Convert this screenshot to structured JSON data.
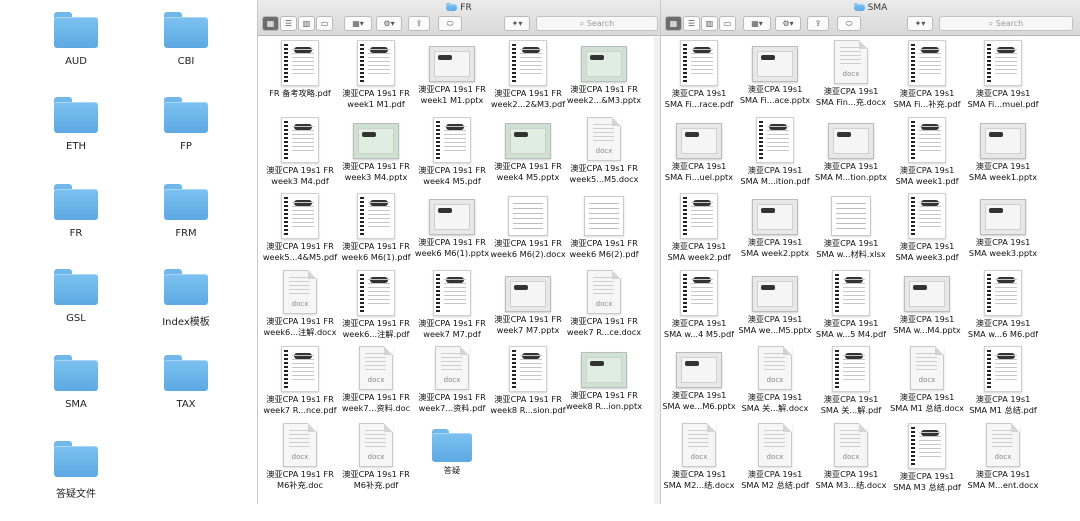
{
  "desktop": {
    "folders": [
      "AUD",
      "CBI",
      "ETH",
      "FP",
      "FR",
      "FRM",
      "GSL",
      "Index模板",
      "SMA",
      "TAX",
      "答疑文件"
    ]
  },
  "windows": [
    {
      "title": "FR",
      "search_placeholder": "Search",
      "toolbar": {
        "share": "⇪",
        "tag": "⬭",
        "dropbox": "✦"
      },
      "items": [
        {
          "name": "FR 备考攻略.pdf",
          "type": "pdf"
        },
        {
          "name": "澳亚CPA 19s1 FR\nweek1 M1.pdf",
          "type": "pdf"
        },
        {
          "name": "澳亚CPA 19s1 FR\nweek1 M1.pptx",
          "type": "ppt"
        },
        {
          "name": "澳亚CPA 19s1 FR\nweek2...2&M3.pdf",
          "type": "pdf"
        },
        {
          "name": "澳亚CPA 19s1 FR\nweek2...&M3.pptx",
          "type": "pptg"
        },
        {
          "name": "澳亚CPA 19s1 FR\nweek3 M4.pdf",
          "type": "pdf"
        },
        {
          "name": "澳亚CPA 19s1 FR\nweek3 M4.pptx",
          "type": "pptg"
        },
        {
          "name": "澳亚CPA 19s1 FR\nweek4 M5.pdf",
          "type": "pdf"
        },
        {
          "name": "澳亚CPA 19s1 FR\nweek4 M5.pptx",
          "type": "pptg"
        },
        {
          "name": "澳亚CPA 19s1 FR\nweek5...M5.docx",
          "type": "doc"
        },
        {
          "name": "澳亚CPA 19s1 FR\nweek5...4&M5.pdf",
          "type": "pdf"
        },
        {
          "name": "澳亚CPA 19s1 FR\nweek6 M6(1).pdf",
          "type": "pdf"
        },
        {
          "name": "澳亚CPA 19s1 FR\nweek6 M6(1).pptx",
          "type": "ppt"
        },
        {
          "name": "澳亚CPA 19s1 FR\nweek6 M6(2).docx",
          "type": "xls"
        },
        {
          "name": "澳亚CPA 19s1 FR\nweek6 M6(2).pdf",
          "type": "xls"
        },
        {
          "name": "澳亚CPA 19s1 FR\nweek6...注解.docx",
          "type": "doc"
        },
        {
          "name": "澳亚CPA 19s1 FR\nweek6...注解.pdf",
          "type": "pdf"
        },
        {
          "name": "澳亚CPA 19s1 FR\nweek7 M7.pdf",
          "type": "pdf"
        },
        {
          "name": "澳亚CPA 19s1 FR\nweek7 M7.pptx",
          "type": "ppt"
        },
        {
          "name": "澳亚CPA 19s1 FR\nweek7 R...ce.docx",
          "type": "doc"
        },
        {
          "name": "澳亚CPA 19s1 FR\nweek7 R...nce.pdf",
          "type": "pdf"
        },
        {
          "name": "澳亚CPA 19s1 FR\nweek7...资料.doc",
          "type": "doc"
        },
        {
          "name": "澳亚CPA 19s1 FR\nweek7...资料.pdf",
          "type": "doc"
        },
        {
          "name": "澳亚CPA 19s1 FR\nweek8 R...sion.pdf",
          "type": "pdf"
        },
        {
          "name": "澳亚CPA 19s1 FR\nweek8 R...ion.pptx",
          "type": "pptg"
        },
        {
          "name": "澳亚CPA 19s1 FR\nM6补充.doc",
          "type": "doc"
        },
        {
          "name": "澳亚CPA 19s1 FR\nM6补充.pdf",
          "type": "doc"
        },
        {
          "name": "答疑",
          "type": "folder"
        }
      ]
    },
    {
      "title": "SMA",
      "search_placeholder": "Search",
      "toolbar": {
        "share": "⇪",
        "tag": "⬭",
        "dropbox": "✦"
      },
      "items": [
        {
          "name": "澳亚CPA 19s1\nSMA Fi...race.pdf",
          "type": "pdf"
        },
        {
          "name": "澳亚CPA 19s1\nSMA Fi...ace.pptx",
          "type": "ppt"
        },
        {
          "name": "澳亚CPA 19s1\nSMA Fin...充.docx",
          "type": "doc"
        },
        {
          "name": "澳亚CPA 19s1\nSMA Fi...补充.pdf",
          "type": "pdf"
        },
        {
          "name": "澳亚CPA 19s1\nSMA Fi...muel.pdf",
          "type": "pdf"
        },
        {
          "name": "澳亚CPA 19s1\nSMA Fi...uel.pptx",
          "type": "ppt"
        },
        {
          "name": "澳亚CPA 19s1\nSMA M...ition.pdf",
          "type": "pdf"
        },
        {
          "name": "澳亚CPA 19s1\nSMA M...tion.pptx",
          "type": "ppt"
        },
        {
          "name": "澳亚CPA 19s1\nSMA week1.pdf",
          "type": "pdf"
        },
        {
          "name": "澳亚CPA 19s1\nSMA week1.pptx",
          "type": "ppt"
        },
        {
          "name": "澳亚CPA 19s1\nSMA week2.pdf",
          "type": "pdf"
        },
        {
          "name": "澳亚CPA 19s1\nSMA week2.pptx",
          "type": "ppt"
        },
        {
          "name": "澳亚CPA 19s1\nSMA w...材料.xlsx",
          "type": "xls"
        },
        {
          "name": "澳亚CPA 19s1\nSMA week3.pdf",
          "type": "pdf"
        },
        {
          "name": "澳亚CPA 19s1\nSMA week3.pptx",
          "type": "ppt"
        },
        {
          "name": "澳亚CPA 19s1\nSMA w...4 M5.pdf",
          "type": "pdf"
        },
        {
          "name": "澳亚CPA 19s1\nSMA we...M5.pptx",
          "type": "ppt"
        },
        {
          "name": "澳亚CPA 19s1\nSMA w...5 M4.pdf",
          "type": "pdf"
        },
        {
          "name": "澳亚CPA 19s1\nSMA w...M4.pptx",
          "type": "ppt"
        },
        {
          "name": "澳亚CPA 19s1\nSMA w...6 M6.pdf",
          "type": "pdf"
        },
        {
          "name": "澳亚CPA 19s1\nSMA we...M6.pptx",
          "type": "ppt"
        },
        {
          "name": "澳亚CPA 19s1\nSMA 关...解.docx",
          "type": "doc"
        },
        {
          "name": "澳亚CPA 19s1\nSMA 关...解.pdf",
          "type": "pdf"
        },
        {
          "name": "澳亚CPA 19s1\nSMA M1 总结.docx",
          "type": "doc"
        },
        {
          "name": "澳亚CPA 19s1\nSMA M1 总结.pdf",
          "type": "pdf"
        },
        {
          "name": "澳亚CPA 19s1\nSMA M2...结.docx",
          "type": "doc"
        },
        {
          "name": "澳亚CPA 19s1\nSMA M2 总结.pdf",
          "type": "doc"
        },
        {
          "name": "澳亚CPA 19s1\nSMA M3...结.docx",
          "type": "doc"
        },
        {
          "name": "澳亚CPA 19s1\nSMA M3 总结.pdf",
          "type": "pdf"
        },
        {
          "name": "澳亚CPA 19s1\nSMA M...ent.docx",
          "type": "doc"
        }
      ]
    }
  ],
  "colors": {
    "folder": "#6db4ea",
    "toolbar_selected": "#6d6d6d"
  }
}
